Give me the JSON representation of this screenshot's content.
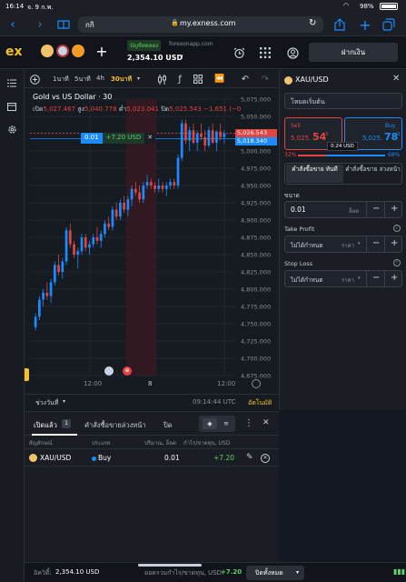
{
  "status": {
    "time": "16:14",
    "date": "จ. 9 ก.พ.",
    "battery": "98%"
  },
  "browser": {
    "tab_label": "กกิ",
    "address": "my.exness.com"
  },
  "header": {
    "logo": "ex",
    "account_type": "บัญชีทดลอง",
    "server": "forexonapp.com",
    "balance": "2,354.10 USD",
    "deposit_label": "ฝากเงิน"
  },
  "toolbar": {
    "timeframes": [
      "1นาที",
      "5นาที",
      "4h",
      "30นาที"
    ],
    "active_timeframe": "30นาที"
  },
  "chart": {
    "title": "Gold vs US Dollar · 30",
    "ohlc": {
      "open_label": "เปิด",
      "open": "5,027.467",
      "high_label": "สูง",
      "high": "5,040.778",
      "low_label": "ต่ำ",
      "low": "5,023.041",
      "close_label": "ปิด",
      "close": "5,025.543",
      "change": "−1.651 (−0"
    },
    "position_tag": {
      "volume": "0.01",
      "pnl": "+7.20 USD",
      "close_x": "✕"
    },
    "sell_price_tag": "5,026.543",
    "buy_price_tag": "5,018.340",
    "x_ticks": [
      "12:00",
      "8",
      "12:00"
    ],
    "period_label": "ช่วงวันที่",
    "clock": "09:14:44 UTC",
    "auto_label": "อัตโนมัติ"
  },
  "chart_data": {
    "type": "candlestick",
    "title": "Gold vs US Dollar · 30",
    "y_ticks": [
      "5,075.000",
      "5,050.000",
      "5,025.000",
      "5,000.000",
      "4,975.000",
      "4,950.000",
      "4,925.000",
      "4,900.000",
      "4,875.000",
      "4,850.000",
      "4,825.000",
      "4,800.000",
      "4,775.000",
      "4,750.000",
      "4,725.000",
      "4,700.000",
      "4,675.000"
    ],
    "ylim": [
      4675,
      5075
    ],
    "candles": [
      [
        4745,
        4765,
        4740,
        4760
      ],
      [
        4760,
        4790,
        4755,
        4785
      ],
      [
        4785,
        4800,
        4775,
        4795
      ],
      [
        4795,
        4810,
        4785,
        4790
      ],
      [
        4790,
        4815,
        4780,
        4810
      ],
      [
        4810,
        4840,
        4805,
        4835
      ],
      [
        4835,
        4850,
        4820,
        4825
      ],
      [
        4825,
        4845,
        4815,
        4840
      ],
      [
        4840,
        4890,
        4835,
        4885
      ],
      [
        4885,
        4895,
        4860,
        4865
      ],
      [
        4865,
        4870,
        4845,
        4850
      ],
      [
        4850,
        4860,
        4830,
        4855
      ],
      [
        4855,
        4880,
        4850,
        4875
      ],
      [
        4875,
        4880,
        4855,
        4860
      ],
      [
        4860,
        4870,
        4850,
        4865
      ],
      [
        4865,
        4880,
        4860,
        4875
      ],
      [
        4875,
        4890,
        4865,
        4870
      ],
      [
        4870,
        4885,
        4860,
        4880
      ],
      [
        4880,
        4900,
        4875,
        4895
      ],
      [
        4895,
        4905,
        4885,
        4890
      ],
      [
        4890,
        4920,
        4885,
        4915
      ],
      [
        4915,
        4925,
        4900,
        4905
      ],
      [
        4905,
        4930,
        4900,
        4925
      ],
      [
        4925,
        4935,
        4910,
        4915
      ],
      [
        4915,
        4935,
        4905,
        4930
      ],
      [
        4930,
        4950,
        4920,
        4945
      ],
      [
        4945,
        4955,
        4935,
        4940
      ],
      [
        4940,
        4950,
        4925,
        4930
      ],
      [
        4930,
        4955,
        4925,
        4950
      ],
      [
        4950,
        4965,
        4945,
        4955
      ],
      [
        4955,
        4960,
        4945,
        4950
      ],
      [
        4950,
        4955,
        4940,
        4945
      ],
      [
        4945,
        4960,
        4940,
        4950
      ],
      [
        4950,
        4955,
        4940,
        4945
      ],
      [
        4945,
        4955,
        4935,
        4950
      ],
      [
        4950,
        4960,
        4945,
        4955
      ],
      [
        4955,
        4960,
        4945,
        4950
      ],
      [
        4950,
        4995,
        4945,
        4990
      ],
      [
        4990,
        5045,
        4985,
        5040
      ],
      [
        5040,
        5045,
        5010,
        5015
      ],
      [
        5015,
        5035,
        5000,
        5030
      ],
      [
        5030,
        5040,
        5010,
        5012
      ],
      [
        5012,
        5030,
        5000,
        5025
      ],
      [
        5025,
        5040,
        5015,
        5020
      ],
      [
        5020,
        5030,
        5000,
        5008
      ],
      [
        5008,
        5035,
        5005,
        5030
      ],
      [
        5030,
        5040,
        5010,
        5012
      ],
      [
        5012,
        5030,
        5000,
        5028
      ],
      [
        5028,
        5040,
        5015,
        5020
      ],
      [
        5020,
        5030,
        5010,
        5025
      ]
    ],
    "shaded_range": [
      24,
      31
    ]
  },
  "order_panel": {
    "symbol": "XAU/USD",
    "mode": "โหมดเริ่มต้น",
    "sell_label": "Sell",
    "sell_price_main": "5,025.",
    "sell_price_big": "54",
    "sell_price_small": "3",
    "buy_label": "Buy",
    "buy_price_main": "5,025.",
    "buy_price_big": "78",
    "buy_price_small": "3",
    "spread": "0.24 USD",
    "sell_pct": "32%",
    "buy_pct": "68%",
    "sell_pct_value": 32,
    "order_type_market": "คำสั่งซื้อขาย ทันที",
    "order_type_pending": "คำสั่งซื้อขาย ล่วงหน้า",
    "volume_label": "ขนาด",
    "volume_value": "0.01",
    "volume_unit": "ล็อต",
    "take_profit_label": "Take Profit",
    "take_profit_value": "ไม่ได้กำหนด",
    "take_profit_unit": "ราคา",
    "stop_loss_label": "Stop Loss",
    "stop_loss_value": "ไม่ได้กำหนด",
    "stop_loss_unit": "ราคา"
  },
  "positions": {
    "tabs": [
      "เปิดแล้ว",
      "คำสั่งซื้อขายล่วงหน้า",
      "ปิด"
    ],
    "open_count": "1",
    "columns": [
      "สัญลักษณ์",
      "ประเภท",
      "ปริมาณ, ล็อต",
      "กำไร/ขาดทุน, USD"
    ],
    "rows": [
      {
        "symbol": "XAU/USD",
        "type": "Buy",
        "volume": "0.01",
        "pnl": "+7.20"
      }
    ]
  },
  "footer": {
    "equity_label": "อิควิตี้:",
    "equity": "2,354.10 USD",
    "total_pnl_label": "ยอดรวมกำไร/ขาดทุน, USD:",
    "total_pnl": "+7.20",
    "close_all_label": "ปิดทั้งหมด"
  },
  "colors": {
    "up": "#1a8cff",
    "down": "#e0453f",
    "accent": "#f5c12a"
  }
}
